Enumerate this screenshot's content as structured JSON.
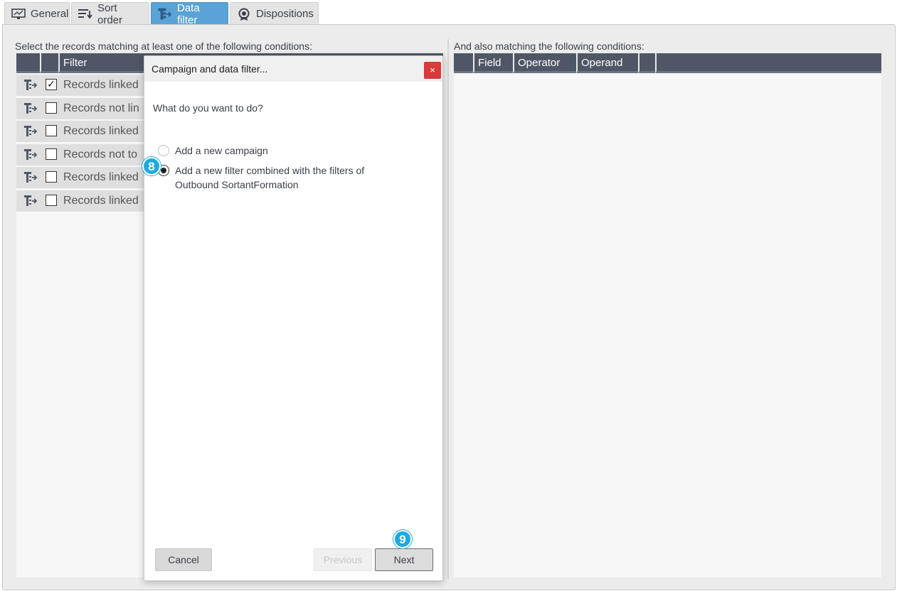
{
  "tabs": [
    {
      "label": "General",
      "icon": "monitor-icon",
      "active": false
    },
    {
      "label": "Sort order",
      "icon": "sort-icon",
      "active": false
    },
    {
      "label": "Data filter",
      "icon": "filter-icon",
      "active": true
    },
    {
      "label": "Dispositions",
      "icon": "badge-icon",
      "active": false
    }
  ],
  "left": {
    "caption": "Select the records matching at least one of the following conditions:",
    "column_header": "Filter",
    "rows": [
      {
        "label": "Records linked",
        "checked": true
      },
      {
        "label": "Records not lin",
        "checked": false
      },
      {
        "label": "Records linked",
        "checked": false
      },
      {
        "label": "Records not to",
        "checked": false
      },
      {
        "label": "Records linked",
        "checked": false
      },
      {
        "label": "Records linked",
        "checked": false
      }
    ]
  },
  "right": {
    "caption": "And also matching the following conditions:",
    "columns": [
      "Field",
      "Operator",
      "Operand"
    ]
  },
  "dialog": {
    "title": "Campaign and data filter...",
    "close_label": "×",
    "question": "What do you want to do?",
    "options": [
      {
        "label": "Add a new campaign",
        "selected": false
      },
      {
        "label_line1": "Add a new filter combined with the filters of",
        "label_line2": "Outbound SortantFormation",
        "selected": true
      }
    ],
    "cancel_label": "Cancel",
    "previous_label": "Previous",
    "next_label": "Next"
  },
  "badges": {
    "step_radio": "8",
    "step_next": "9"
  },
  "colors": {
    "accent": "#5aa3d6",
    "header": "#4f5766",
    "close": "#d93a3a",
    "badge": "#1fa9dc"
  }
}
